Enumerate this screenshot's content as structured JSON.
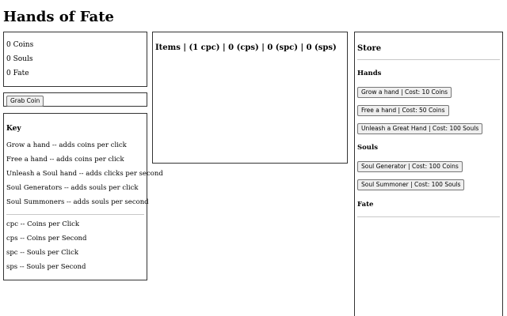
{
  "app": {
    "title": "Hands of Fate"
  },
  "stats": {
    "coins": "0 Coins",
    "souls": "0 Souls",
    "fate": "0 Fate"
  },
  "grab": {
    "label": "Grab Coin"
  },
  "key": {
    "heading": "Key",
    "items": [
      "Grow a hand -- adds coins per click",
      "Free a hand -- adds coins per click",
      "Unleash a Soul hand -- adds clicks per second",
      "Soul Generators -- adds souls per click",
      "Soul Summoners -- adds souls per second"
    ],
    "abbreviations": [
      "cpc -- Coins per Click",
      "cps -- Coins per Second",
      "spc -- Souls per Click",
      "sps -- Souls per Second"
    ]
  },
  "items": {
    "title": "Items | (1 cpc) | 0 (cps) | 0 (spc) | 0 (sps)"
  },
  "store": {
    "title": "Store",
    "hands": {
      "title": "Hands",
      "buttons": [
        "Grow a hand | Cost: 10 Coins",
        "Free a hand | Cost: 50 Coins",
        "Unleash a Great Hand | Cost: 100 Souls"
      ]
    },
    "souls": {
      "title": "Souls",
      "buttons": [
        "Soul Generator | Cost: 100 Coins",
        "Soul Summoner | Cost: 100 Souls"
      ]
    },
    "fate": {
      "title": "Fate"
    }
  }
}
